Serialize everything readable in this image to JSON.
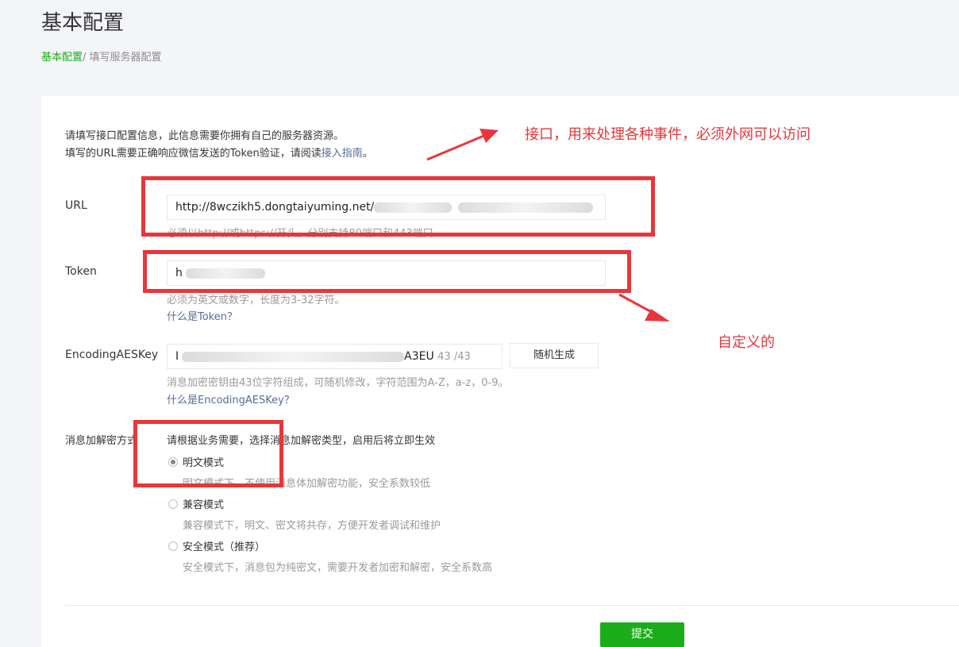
{
  "page": {
    "title": "基本配置",
    "breadcrumb": {
      "current": "基本配置",
      "separator": "/",
      "sub": " 填写服务器配置"
    }
  },
  "intro": {
    "line1": "请填写接口配置信息，此信息需要你拥有自己的服务器资源。",
    "line2_prefix": "填写的URL需要正确响应微信发送的Token验证，请阅读",
    "line2_link": "接入指南",
    "line2_suffix": "。"
  },
  "url_field": {
    "label": "URL",
    "value": "http://8wczikh5.dongtaiyuming.net/",
    "hint": "必须以http://或https://开头，分别支持80端口和443端口"
  },
  "token_field": {
    "label": "Token",
    "value": "h",
    "hint": "必须为英文或数字，长度为3-32字符。",
    "help": "什么是Token？"
  },
  "aes_field": {
    "label": "EncodingAESKey",
    "value_start": "I",
    "value_end": "A3EU",
    "counter": "43 /43",
    "generate_button": "随机生成",
    "hint": "消息加密密钥由43位字符组成，可随机修改，字符范围为A-Z，a-z，0-9。",
    "help": "什么是EncodingAESKey？"
  },
  "encryption": {
    "label": "消息加解密方式",
    "description": "请根据业务需要，选择消息加解密类型，启用后将立即生效",
    "options": [
      {
        "label": "明文模式",
        "hint": "明文模式下，不使用消息体加解密功能，安全系数较低",
        "checked": true
      },
      {
        "label": "兼容模式",
        "hint": "兼容模式下，明文、密文将共存，方便开发者调试和维护",
        "checked": false
      },
      {
        "label": "安全模式（推荐）",
        "hint": "安全模式下，消息包为纯密文，需要开发者加密和解密，安全系数高",
        "checked": false
      }
    ]
  },
  "submit_button": "提交",
  "annotations": {
    "interface_note": "接口，用来处理各种事件，必须外网可以访问",
    "custom_note": "自定义的"
  },
  "colors": {
    "accent_green": "#1aad19",
    "link_blue": "#576b95",
    "annotation_red": "#e8363b"
  }
}
